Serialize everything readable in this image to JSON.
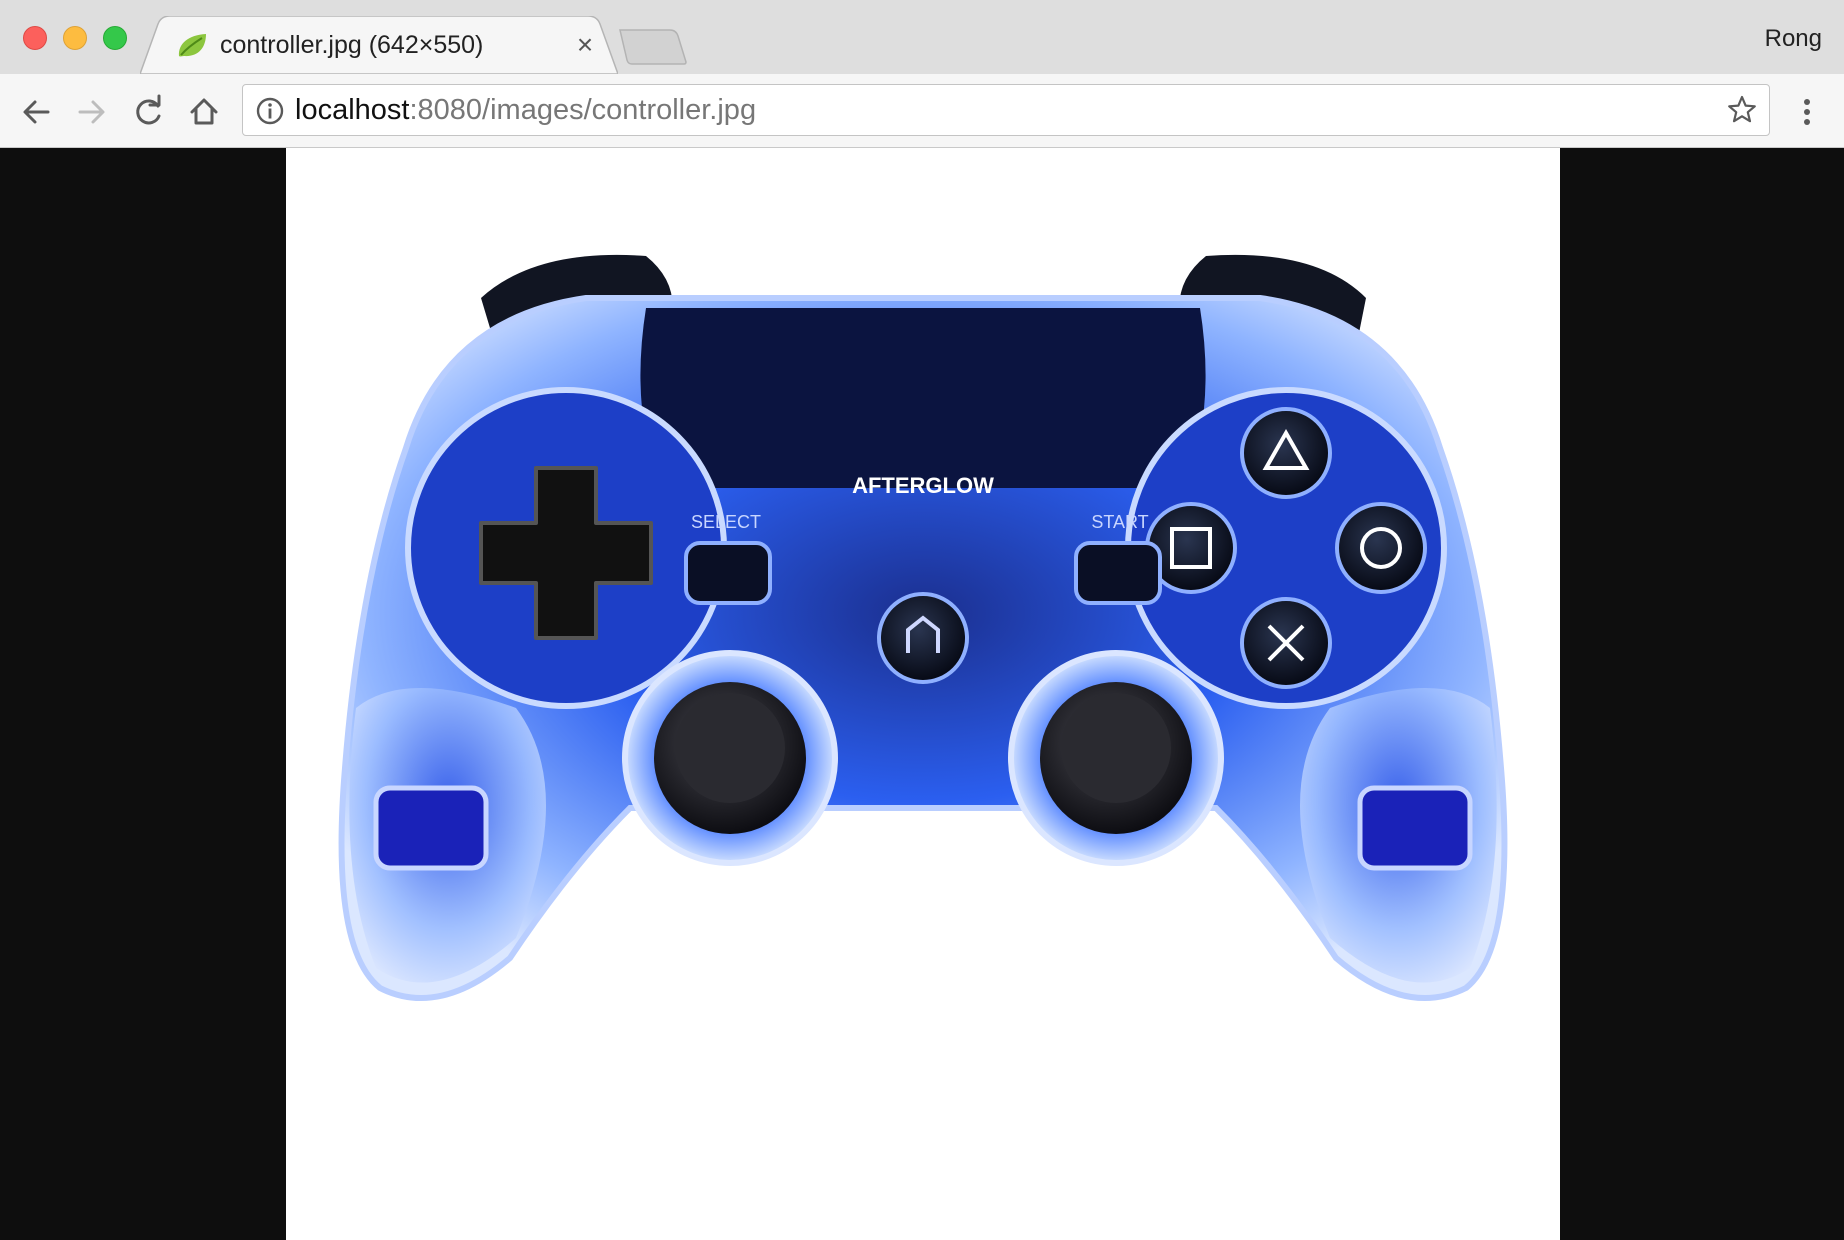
{
  "tab": {
    "title": "controller.jpg (642×550)",
    "close_glyph": "×",
    "favicon": "leaf-icon"
  },
  "profile": {
    "name": "Rong"
  },
  "toolbar": {
    "icons": [
      "back-arrow-icon",
      "forward-arrow-icon",
      "reload-icon",
      "home-icon",
      "info-icon",
      "star-icon",
      "more-vert-icon"
    ]
  },
  "address_bar": {
    "host": "localhost",
    "rest": ":8080/images/controller.jpg"
  },
  "image": {
    "subject": "game-controller",
    "logo_text": "AFTERGLOW",
    "select_label": "SELECT",
    "start_label": "START"
  },
  "colors": {
    "tabstrip": "#dedede",
    "toolbar": "#f6f6f6",
    "viewer_background": "#0e0e0e",
    "controller_glow": "#1a4dff"
  }
}
